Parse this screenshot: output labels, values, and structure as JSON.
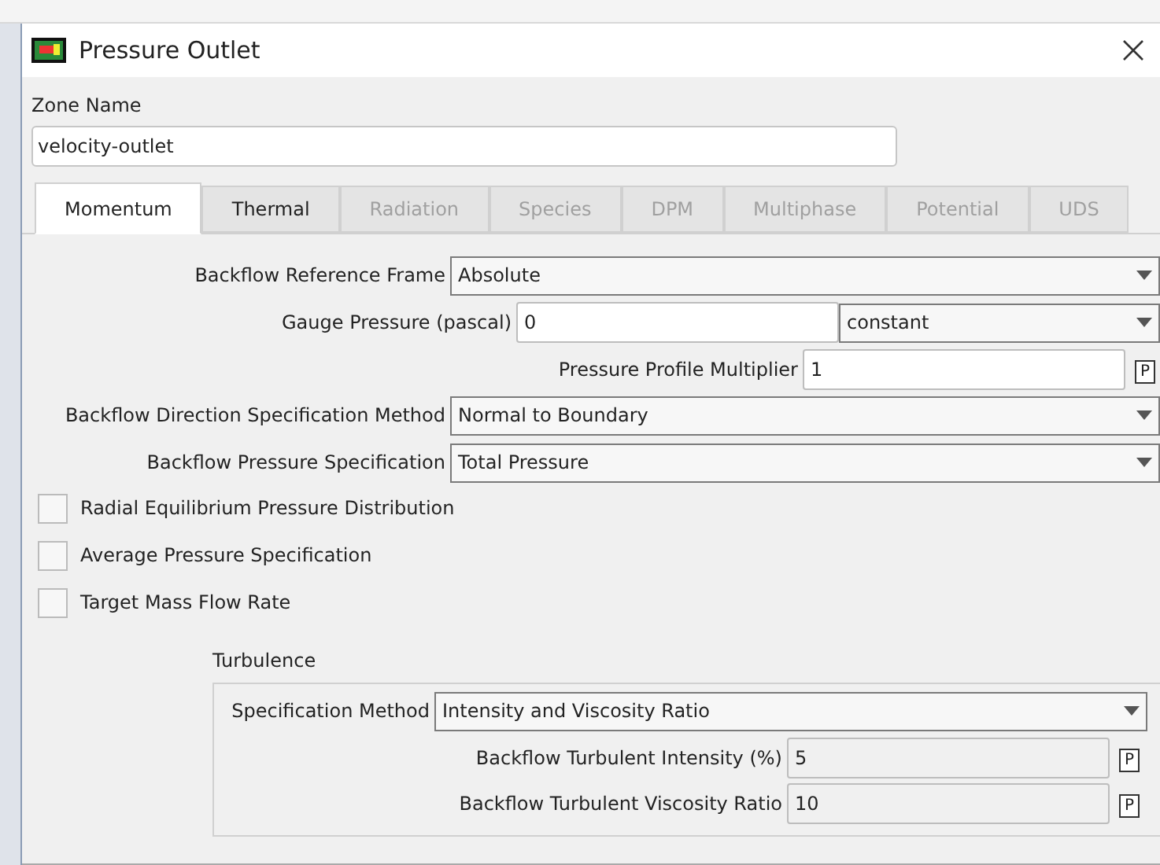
{
  "window": {
    "title": "Pressure Outlet"
  },
  "zone_name": {
    "label": "Zone Name",
    "value": "velocity-outlet"
  },
  "tabs": [
    {
      "label": "Momentum",
      "selected": true,
      "disabled": false
    },
    {
      "label": "Thermal",
      "selected": false,
      "disabled": false
    },
    {
      "label": "Radiation",
      "selected": false,
      "disabled": true
    },
    {
      "label": "Species",
      "selected": false,
      "disabled": true
    },
    {
      "label": "DPM",
      "selected": false,
      "disabled": true
    },
    {
      "label": "Multiphase",
      "selected": false,
      "disabled": true
    },
    {
      "label": "Potential",
      "selected": false,
      "disabled": true
    },
    {
      "label": "UDS",
      "selected": false,
      "disabled": true
    }
  ],
  "fields": [
    {
      "kind": "dropdown",
      "label": "Backflow Reference Frame",
      "value": "Absolute"
    },
    {
      "kind": "input_dropdown",
      "label": "Gauge Pressure (pascal)",
      "value": "0",
      "option": "constant"
    },
    {
      "kind": "profile",
      "label": "Pressure Profile Multiplier",
      "value": "1",
      "button": "P"
    },
    {
      "kind": "dropdown",
      "label": "Backflow Direction Specification Method",
      "value": "Normal to Boundary"
    },
    {
      "kind": "dropdown",
      "label": "Backflow Pressure Specification",
      "value": "Total Pressure"
    }
  ],
  "checkboxes": [
    {
      "label": "Radial Equilibrium Pressure Distribution",
      "checked": false
    },
    {
      "label": "Average Pressure Specification",
      "checked": false
    },
    {
      "label": "Target Mass Flow Rate",
      "checked": false
    }
  ],
  "turbulence": {
    "title": "Turbulence",
    "fields": [
      {
        "kind": "dropdown",
        "label": "Specification Method",
        "value": "Intensity and Viscosity Ratio"
      },
      {
        "kind": "profile",
        "label": "Backflow Turbulent Intensity (%)",
        "value": "5",
        "button": "P"
      },
      {
        "kind": "profile",
        "label": "Backflow Turbulent Viscosity Ratio",
        "value": "10",
        "button": "P"
      }
    ]
  }
}
